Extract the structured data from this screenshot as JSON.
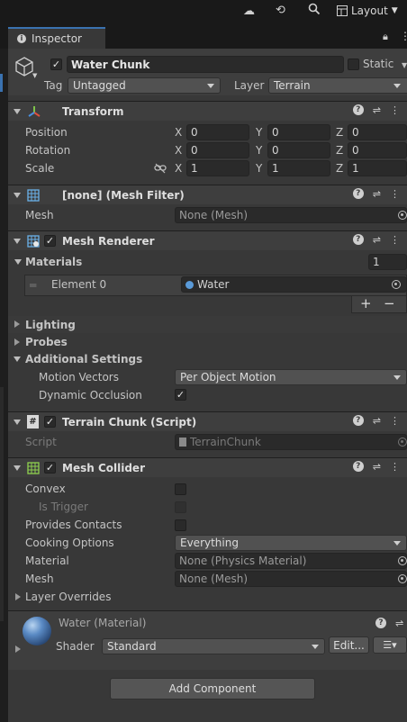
{
  "toolbar": {
    "layout_label": "Layout"
  },
  "tab": {
    "label": "Inspector"
  },
  "object": {
    "name": "Water Chunk",
    "static_label": "Static",
    "tag_label": "Tag",
    "tag_value": "Untagged",
    "layer_label": "Layer",
    "layer_value": "Terrain"
  },
  "transform": {
    "title": "Transform",
    "position_label": "Position",
    "rotation_label": "Rotation",
    "scale_label": "Scale",
    "x": "X",
    "y": "Y",
    "z": "Z",
    "position": [
      "0",
      "0",
      "0"
    ],
    "rotation": [
      "0",
      "0",
      "0"
    ],
    "scale": [
      "1",
      "1",
      "1"
    ]
  },
  "mesh_filter": {
    "title": "[none] (Mesh Filter)",
    "mesh_label": "Mesh",
    "mesh_value": "None (Mesh)"
  },
  "mesh_renderer": {
    "title": "Mesh Renderer",
    "materials_label": "Materials",
    "materials_count": "1",
    "element0_label": "Element 0",
    "element0_value": "Water",
    "plus": "+",
    "minus": "−",
    "lighting_label": "Lighting",
    "probes_label": "Probes",
    "additional_label": "Additional Settings",
    "motion_vectors_label": "Motion Vectors",
    "motion_vectors_value": "Per Object Motion",
    "dynamic_occlusion_label": "Dynamic Occlusion"
  },
  "terrain_chunk": {
    "title": "Terrain Chunk (Script)",
    "script_label": "Script",
    "script_value": "TerrainChunk"
  },
  "mesh_collider": {
    "title": "Mesh Collider",
    "convex_label": "Convex",
    "is_trigger_label": "Is Trigger",
    "provides_contacts_label": "Provides Contacts",
    "cooking_options_label": "Cooking Options",
    "cooking_options_value": "Everything",
    "material_label": "Material",
    "material_value": "None (Physics Material)",
    "mesh_label": "Mesh",
    "mesh_value": "None (Mesh)",
    "layer_overrides_label": "Layer Overrides"
  },
  "material": {
    "title": "Water (Material)",
    "shader_label": "Shader",
    "shader_value": "Standard",
    "edit_label": "Edit...",
    "add_component_label": "Add Component"
  },
  "colors": {
    "panel": "#383838",
    "field": "#2a2a2a",
    "accent": "#3a72b0"
  }
}
